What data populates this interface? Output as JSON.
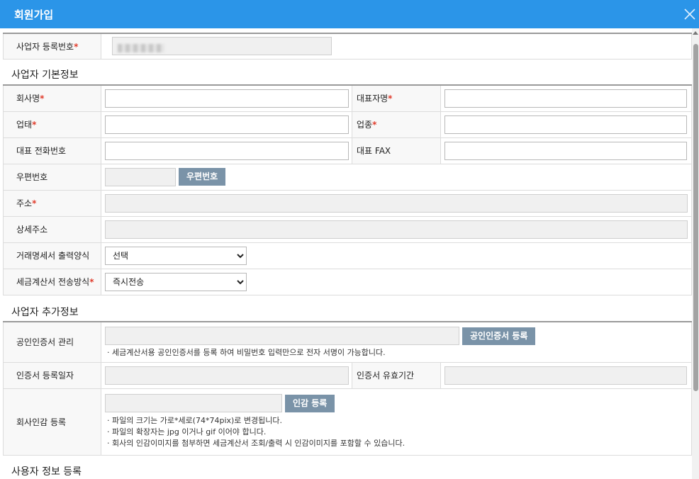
{
  "window": {
    "title": "회원가입",
    "close_icon": "close-icon"
  },
  "registration": {
    "label": "사업자 등록번호",
    "value": ""
  },
  "sections": {
    "basic": "사업자 기본정보",
    "extra": "사업자 추가정보",
    "user": "사용자 정보 등록"
  },
  "basic": {
    "company_name_label": "회사명",
    "ceo_name_label": "대표자명",
    "business_type_label": "업태",
    "business_item_label": "업종",
    "phone_label": "대표 전화번호",
    "fax_label": "대표 FAX",
    "zipcode_label": "우편번호",
    "zipcode_button": "우편번호",
    "address_label": "주소",
    "address_detail_label": "상세주소",
    "invoice_format_label": "거래명세서 출력양식",
    "invoice_format_value": "선택",
    "tax_send_label": "세금계산서 전송방식",
    "tax_send_value": "즉시전송"
  },
  "extra": {
    "cert_label": "공인인증서 관리",
    "cert_button": "공인인증서 등록",
    "cert_note": "· 세금계산서용 공인인증서를 등록 하여 비밀번호 입력만으로 전자 서명이 가능합니다.",
    "cert_date_label": "인증서 등록일자",
    "cert_expiry_label": "인증서 유효기간",
    "seal_label": "회사인감 등록",
    "seal_button": "인감 등록",
    "seal_notes": [
      "· 파일의 크기는 가로*세로(74*74pix)로 변경됩니다.",
      "· 파일의 확장자는 jpg 이거나 gif 이어야 합니다.",
      "· 회사의 인감이미지를 첨부하면 세금계산서 조회/출력 시 인감이미지를 포함할 수 있습니다."
    ]
  },
  "required_mark": "*",
  "colors": {
    "titlebar": "#2b95e8",
    "button": "#7a93a8",
    "required": "#e03c2c"
  }
}
